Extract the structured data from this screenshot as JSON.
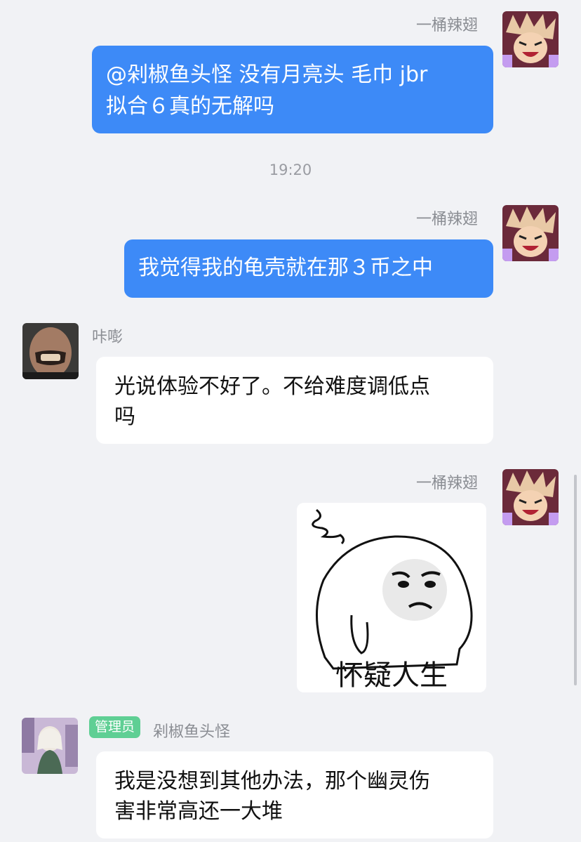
{
  "messages": [
    {
      "sender": "一桶辣翅",
      "text_lines": [
        "@剁椒鱼头怪 没有月亮头 毛巾 jbr",
        "拟合６真的无解吗"
      ]
    },
    {
      "timestamp": "19:20"
    },
    {
      "sender": "一桶辣翅",
      "text": "我觉得我的龟壳就在那３币之中"
    },
    {
      "sender": "咔嘭",
      "text_lines": [
        "光说体验不好了。不给难度调低点",
        "吗"
      ]
    },
    {
      "sender": "一桶辣翅",
      "sticker_caption": "怀疑人生"
    },
    {
      "sender": "剁椒鱼头怪",
      "role_badge": "管理员",
      "text_lines": [
        "我是没想到其他办法，那个幽灵伤",
        "害非常高还一大堆"
      ]
    }
  ],
  "colors": {
    "outgoing_bubble": "#3d8af7",
    "admin_badge": "#5fcf94",
    "background": "#f1f2f5"
  },
  "icons": {
    "avatar_self": "anime-avatar-icon",
    "avatar_kapeng": "portrait-avatar-icon",
    "avatar_admin": "illustration-avatar-icon"
  }
}
